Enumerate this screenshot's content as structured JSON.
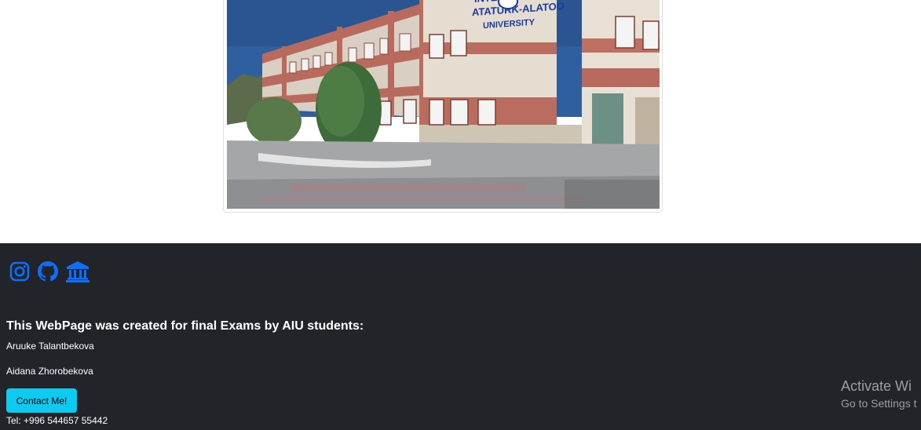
{
  "image": {
    "alt": ""
  },
  "footer": {
    "social": [
      {
        "icon": "instagram-icon",
        "color": "#0d6efd"
      },
      {
        "icon": "github-icon",
        "color": "#0d6efd"
      },
      {
        "icon": "bank-icon",
        "color": "#0d6efd"
      }
    ],
    "heading": "This WebPage was created for final Exams by AIU students:",
    "authors": [
      "Aruuke Talantbekova",
      "Aidana Zhorobekova"
    ],
    "contact_button": "Contact Me!",
    "phone": "Tel: +996 544657 55442"
  },
  "watermark": {
    "title": "Activate Wi",
    "subtitle": "Go to Settings t"
  },
  "colors": {
    "footer_bg": "#212529",
    "icon_blue": "#0d6efd",
    "button_cyan": "#0dcaf0"
  }
}
